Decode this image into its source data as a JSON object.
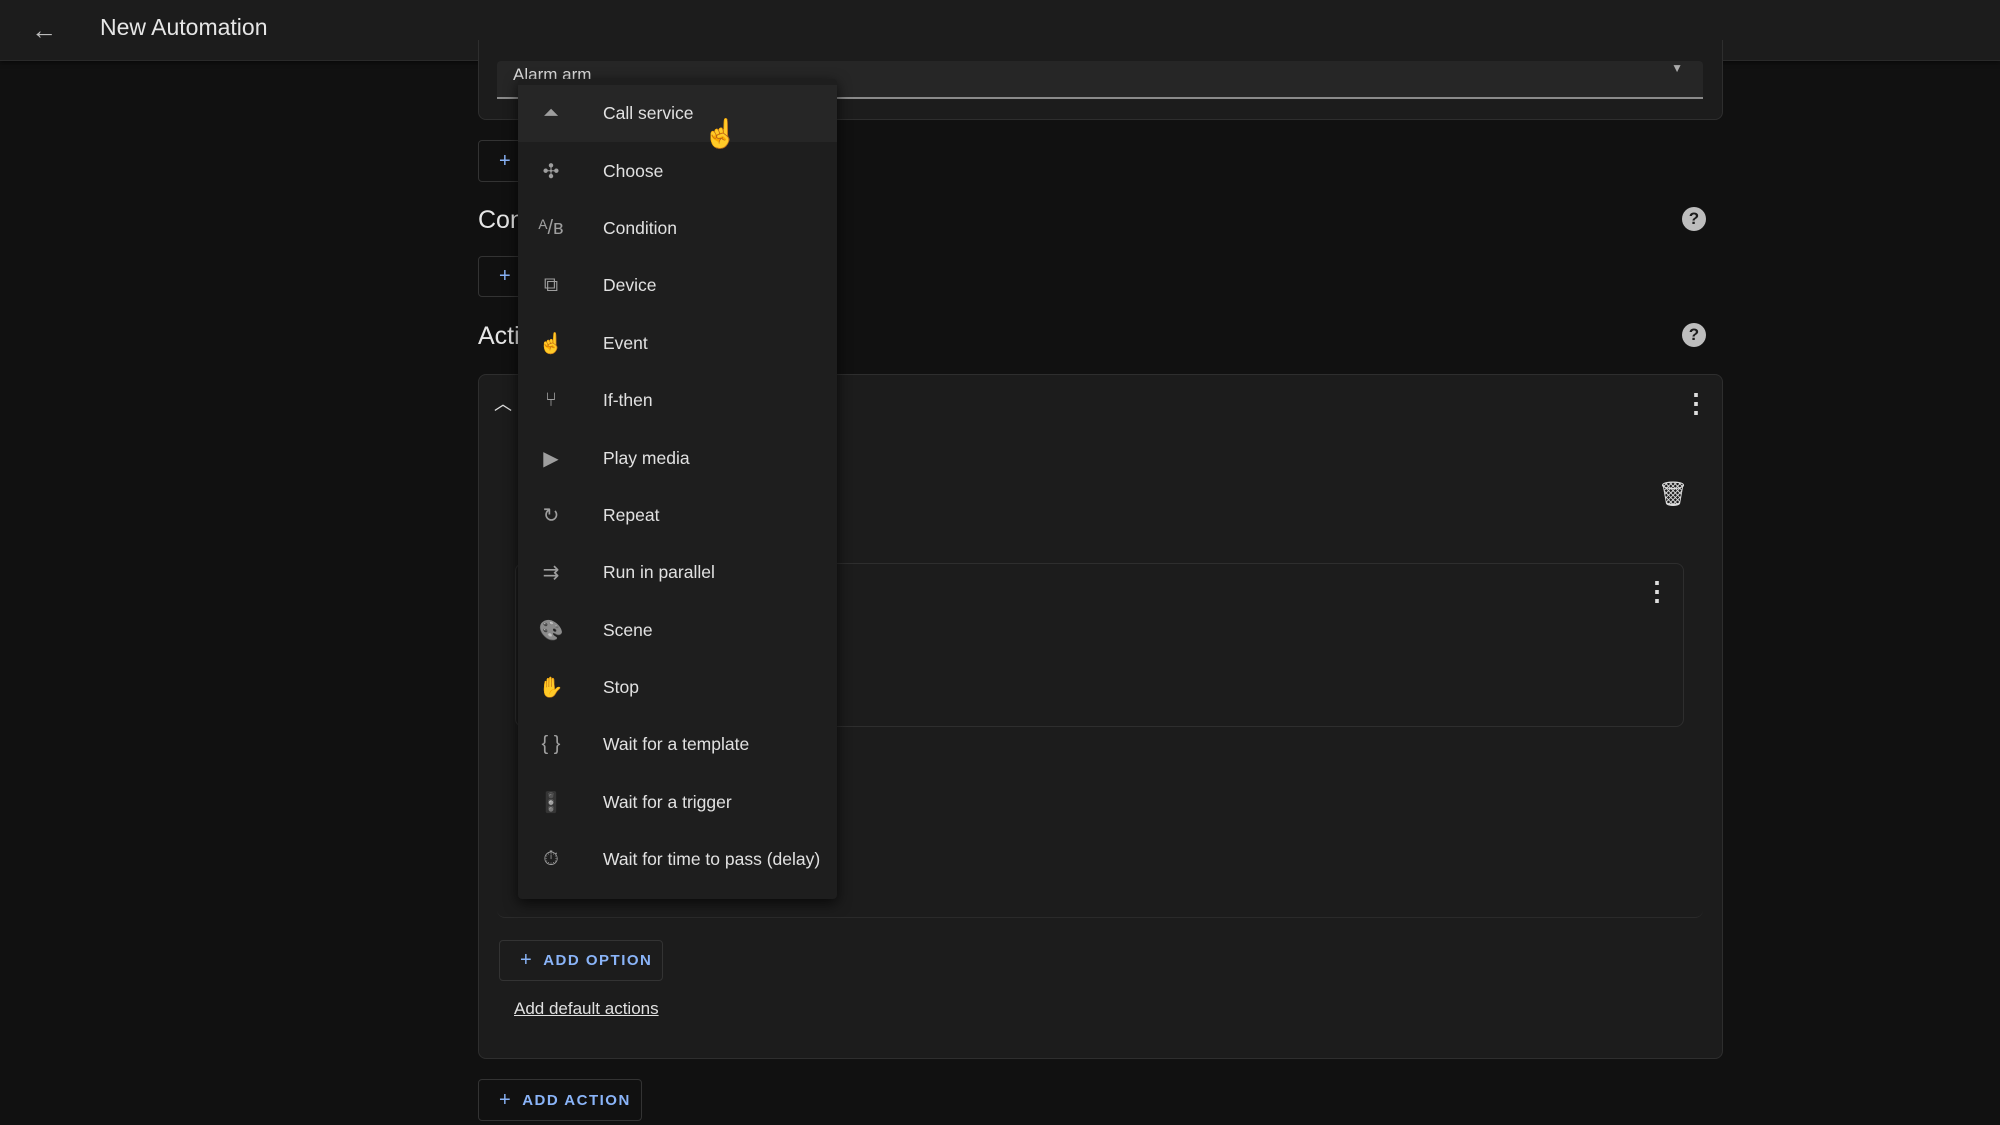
{
  "header": {
    "title": "New Automation",
    "back_icon": "arrow-left-icon"
  },
  "trigger": {
    "field_value": "Alarm arm"
  },
  "sections": {
    "conditions": "Conditions",
    "actions": "Actions"
  },
  "menu": {
    "items": [
      {
        "label": "Call service",
        "icon": "bell-icon",
        "glyph": "⏶"
      },
      {
        "label": "Choose",
        "icon": "arrows-split-icon",
        "glyph": "✣"
      },
      {
        "label": "Condition",
        "icon": "a-b-icon",
        "glyph": "ᴬ/ʙ"
      },
      {
        "label": "Device",
        "icon": "devices-icon",
        "glyph": "⧉"
      },
      {
        "label": "Event",
        "icon": "gesture-tap-icon",
        "glyph": "☝"
      },
      {
        "label": "If-then",
        "icon": "call-split-icon",
        "glyph": "⑂"
      },
      {
        "label": "Play media",
        "icon": "play-icon",
        "glyph": "▶"
      },
      {
        "label": "Repeat",
        "icon": "refresh-icon",
        "glyph": "↻"
      },
      {
        "label": "Run in parallel",
        "icon": "parallel-arrows-icon",
        "glyph": "⇉"
      },
      {
        "label": "Scene",
        "icon": "palette-icon",
        "glyph": "🎨"
      },
      {
        "label": "Stop",
        "icon": "hand-icon",
        "glyph": "✋"
      },
      {
        "label": "Wait for a template",
        "icon": "code-braces-icon",
        "glyph": "{ }"
      },
      {
        "label": "Wait for a trigger",
        "icon": "traffic-light-icon",
        "glyph": "🚦"
      },
      {
        "label": "Wait for time to pass (delay)",
        "icon": "timer-icon",
        "glyph": "⏱"
      }
    ]
  },
  "buttons": {
    "add_option": "ADD OPTION",
    "add_default_actions": "Add default actions",
    "add_action": "ADD ACTION",
    "plus": "+"
  },
  "help_glyph": "?"
}
